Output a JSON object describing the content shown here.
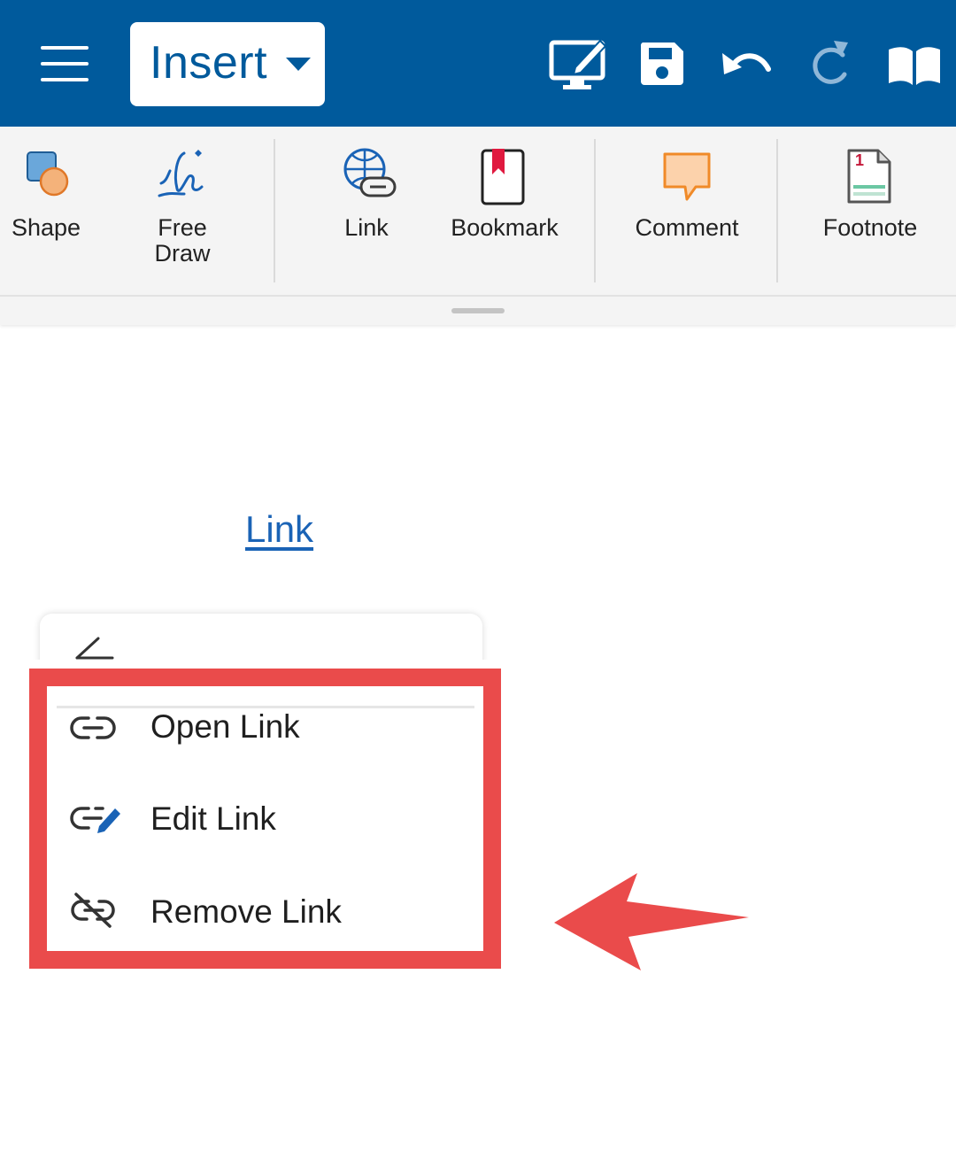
{
  "toolbar": {
    "mode_label": "Insert",
    "icons": [
      "menu-icon",
      "edit-mode-icon",
      "save-icon",
      "undo-icon",
      "redo-icon",
      "read-mode-icon"
    ]
  },
  "ribbon": {
    "items": [
      {
        "label": "Shape",
        "icon": "shape-icon"
      },
      {
        "label": "Free Draw",
        "icon": "free-draw-icon"
      },
      {
        "label": "Link",
        "icon": "link-icon"
      },
      {
        "label": "Bookmark",
        "icon": "bookmark-icon"
      },
      {
        "label": "Comment",
        "icon": "comment-icon"
      },
      {
        "label": "Footnote",
        "icon": "footnote-icon"
      }
    ],
    "footnote_number": "1"
  },
  "document": {
    "link_text": "Link"
  },
  "context_menu": {
    "items": [
      {
        "label": "Open Link",
        "icon": "open-link-icon"
      },
      {
        "label": "Edit Link",
        "icon": "edit-link-icon"
      },
      {
        "label": "Remove Link",
        "icon": "remove-link-icon"
      }
    ]
  },
  "colors": {
    "appbar": "#005a9c",
    "annotation": "#ea4b4b",
    "link": "#1a63b6"
  }
}
